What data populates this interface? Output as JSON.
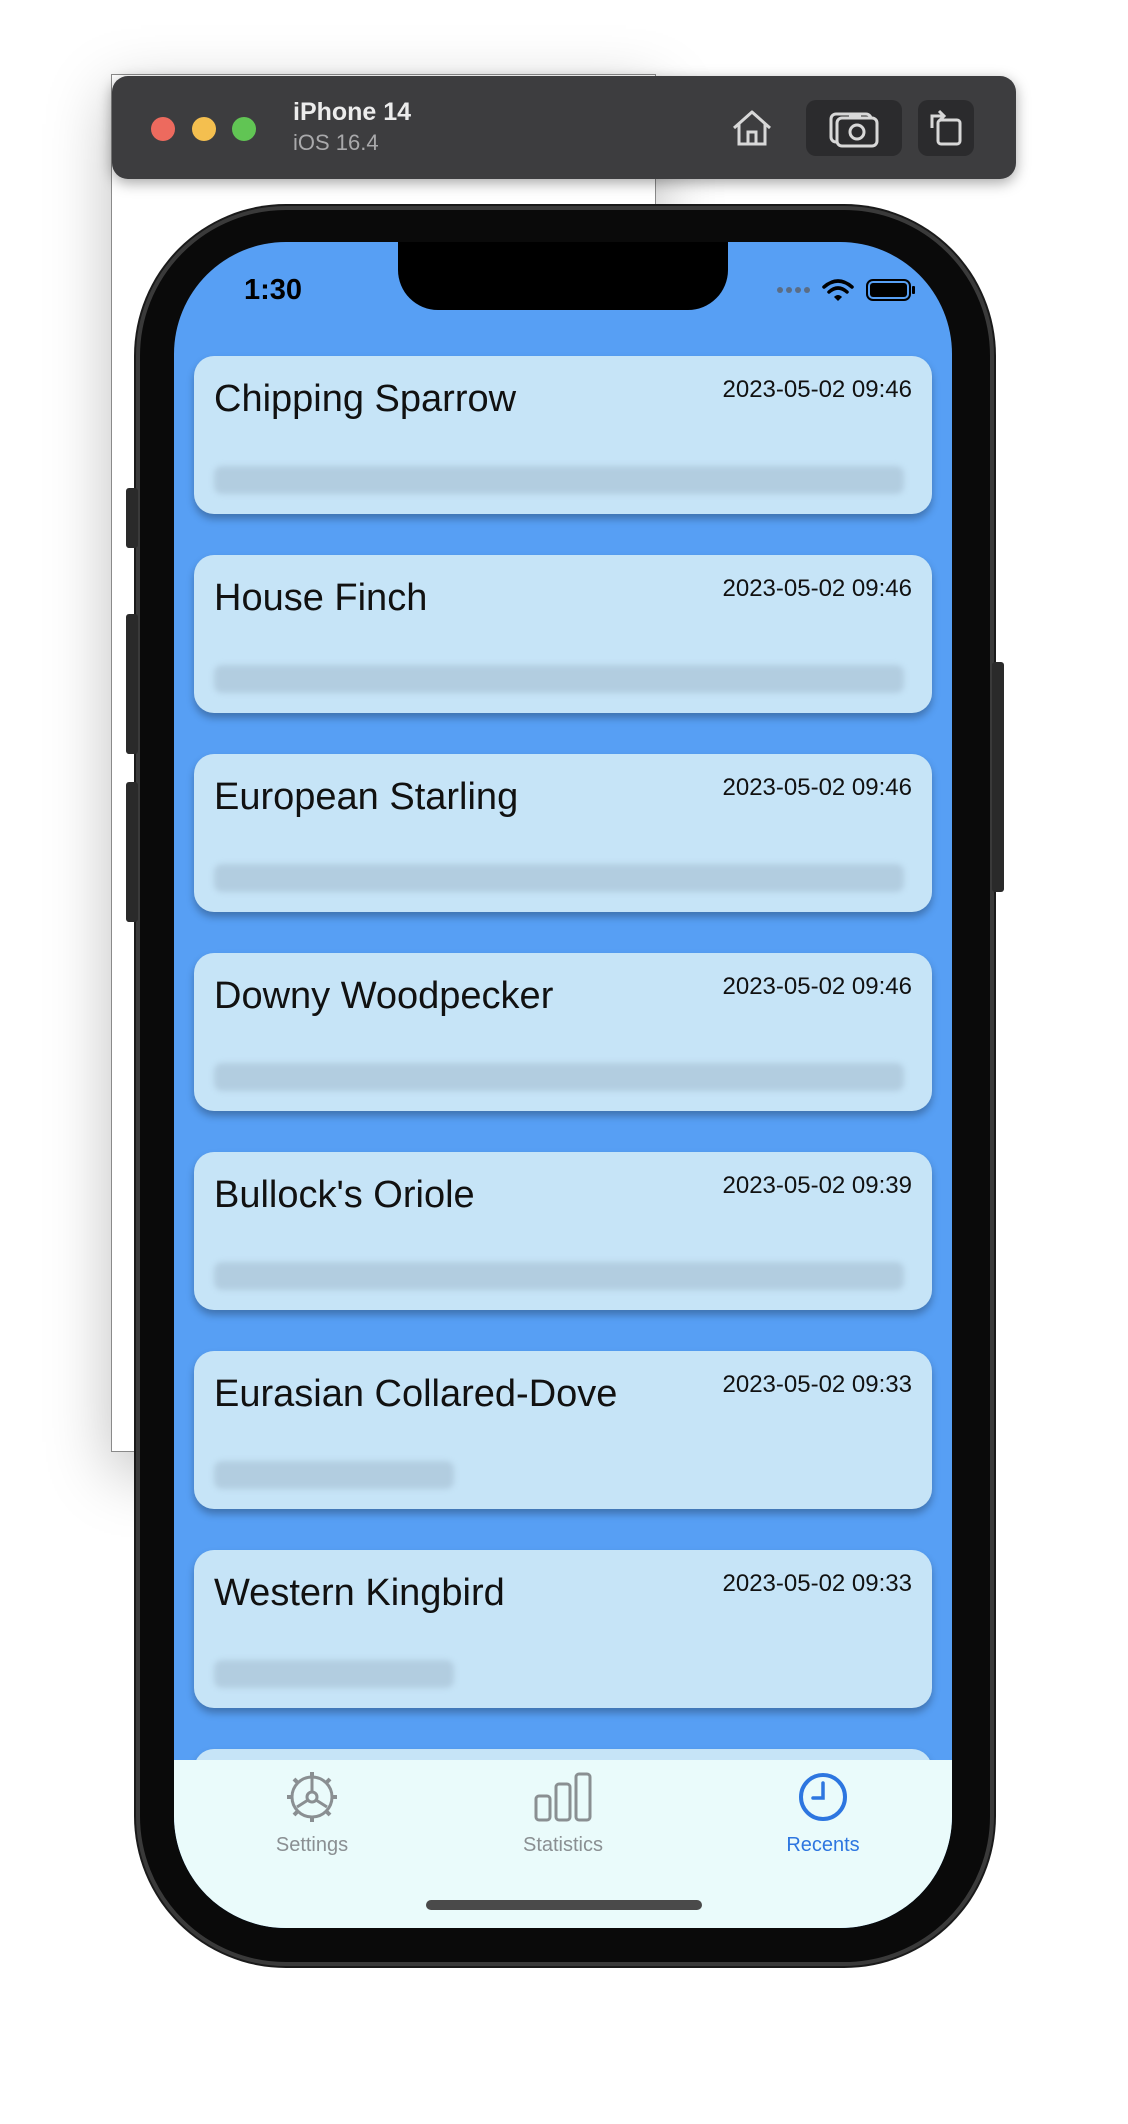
{
  "simulator": {
    "device_name": "iPhone 14",
    "os_version": "iOS 16.4",
    "toolbar_icons": [
      "home-icon",
      "screenshot-icon",
      "rotate-icon"
    ]
  },
  "status_bar": {
    "time": "1:30",
    "icons": [
      "cellular-dots-icon",
      "wifi-icon",
      "battery-icon"
    ]
  },
  "sightings": [
    {
      "name": "Chipping Sparrow",
      "timestamp": "2023-05-02 09:46"
    },
    {
      "name": "House Finch",
      "timestamp": "2023-05-02 09:46"
    },
    {
      "name": "European Starling",
      "timestamp": "2023-05-02 09:46"
    },
    {
      "name": "Downy Woodpecker",
      "timestamp": "2023-05-02 09:46"
    },
    {
      "name": "Bullock's Oriole",
      "timestamp": "2023-05-02 09:39"
    },
    {
      "name": "Eurasian Collared-Dove",
      "timestamp": "2023-05-02 09:33"
    },
    {
      "name": "Western Kingbird",
      "timestamp": "2023-05-02 09:33"
    }
  ],
  "tabs": [
    {
      "label": "Settings",
      "icon": "gear-icon",
      "active": false
    },
    {
      "label": "Statistics",
      "icon": "bar-chart-icon",
      "active": false
    },
    {
      "label": "Recents",
      "icon": "clock-icon",
      "active": true
    }
  ],
  "colors": {
    "screen_background": "#579ff4",
    "card_background": "#c6e4f7",
    "tab_bar_background": "#eafbfb",
    "active_tab": "#2d76e0",
    "inactive_tab": "#8a8f92"
  }
}
